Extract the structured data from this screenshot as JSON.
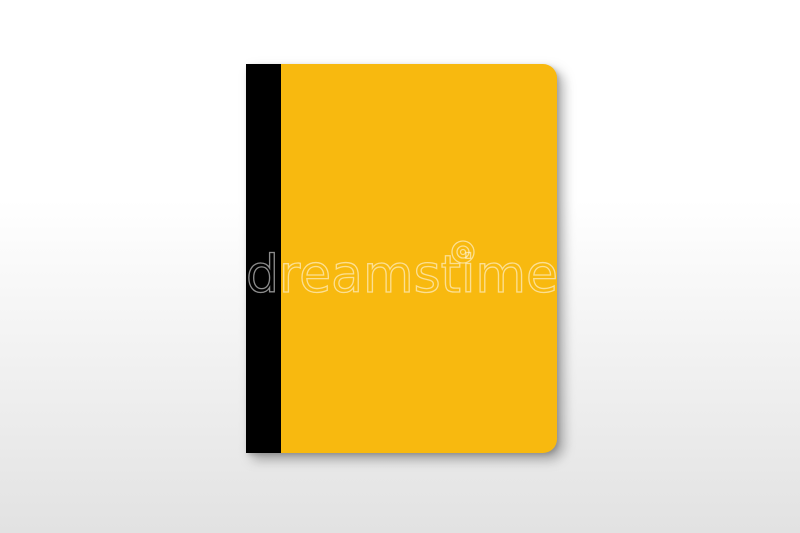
{
  "colors": {
    "cover": "#F8B90F",
    "spine": "#000000"
  },
  "watermark": {
    "text": "dreamstime"
  }
}
